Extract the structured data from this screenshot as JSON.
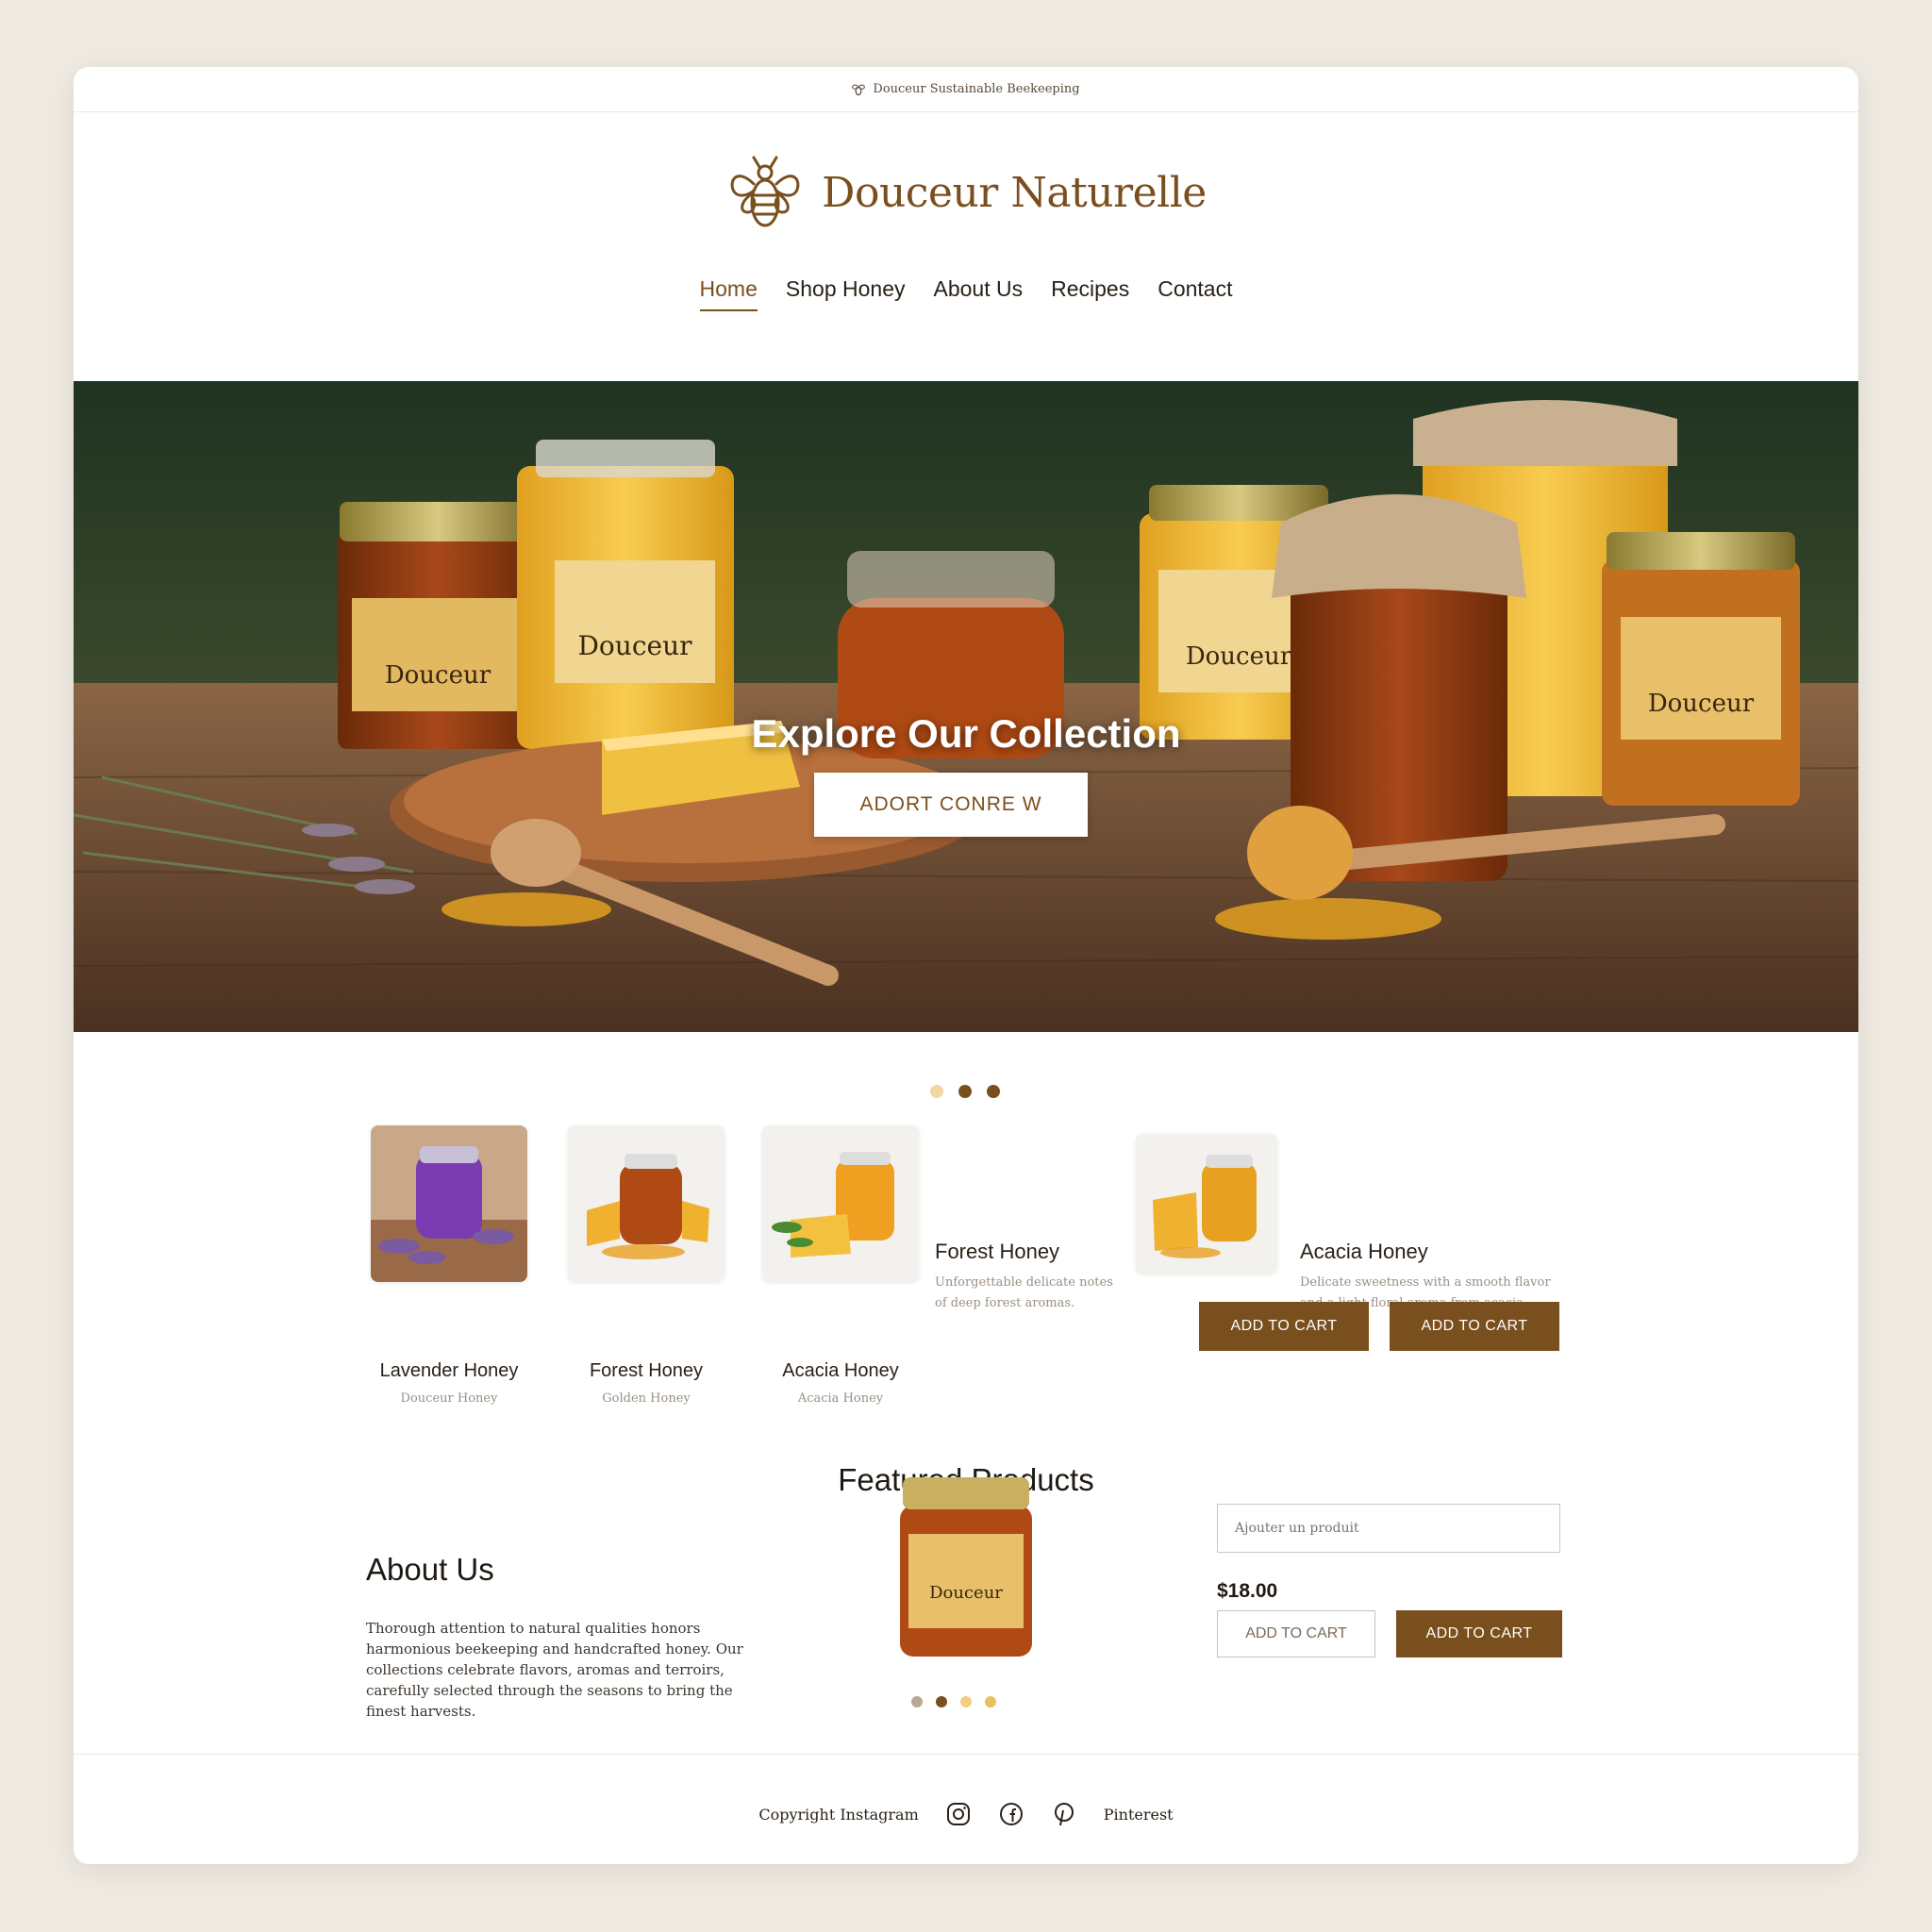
{
  "topbar": {
    "text": "Douceur Sustainable Beekeeping"
  },
  "brand": {
    "name": "Douceur Naturelle"
  },
  "nav": {
    "items": [
      "Home",
      "Shop Honey",
      "About Us",
      "Recipes",
      "Contact"
    ],
    "active": "Home"
  },
  "hero": {
    "title": "Explore Our Collection",
    "button": "ADORT CONRE W",
    "jar_label": "Douceur"
  },
  "products_row": {
    "cards": [
      {
        "name": "Lavender Honey",
        "sub": "Douceur Honey"
      },
      {
        "name": "Forest Honey",
        "sub": "Golden Honey"
      },
      {
        "name": "Acacia Honey",
        "sub": "Acacia Honey"
      }
    ],
    "side": [
      {
        "name": "Forest Honey",
        "desc_line1": "Unforgettable delicate notes",
        "desc_line2": "of deep forest aromas."
      },
      {
        "name": "Acacia Honey",
        "desc_line1": "Delicate sweetness with a smooth flavor",
        "desc_line2": "and a light floral aroma from acacia."
      }
    ],
    "add_to_cart_1": "ADD TO CART",
    "add_to_cart_2": "ADD TO CART"
  },
  "featured": {
    "title": "Featured Products",
    "jar_label": "Douceur",
    "input_placeholder": "Ajouter un produit",
    "price": "$18.00",
    "btn_outline": "ADD TO CART",
    "btn_solid": "ADD TO CART"
  },
  "about": {
    "title": "About Us",
    "text": "Thorough attention to natural qualities honors harmonious beekeeping and handcrafted honey. Our collections celebrate flavors, aromas and terroirs, carefully selected through the seasons to bring the finest harvests."
  },
  "footer": {
    "copyright": "Copyright Instagram",
    "pinterest": "Pinterest"
  },
  "colors": {
    "brand_brown": "#7a4f1e",
    "honey_gold": "#e9c46a",
    "dot_light": "#f0d9a0",
    "dot_dark": "#7a4f1e"
  }
}
